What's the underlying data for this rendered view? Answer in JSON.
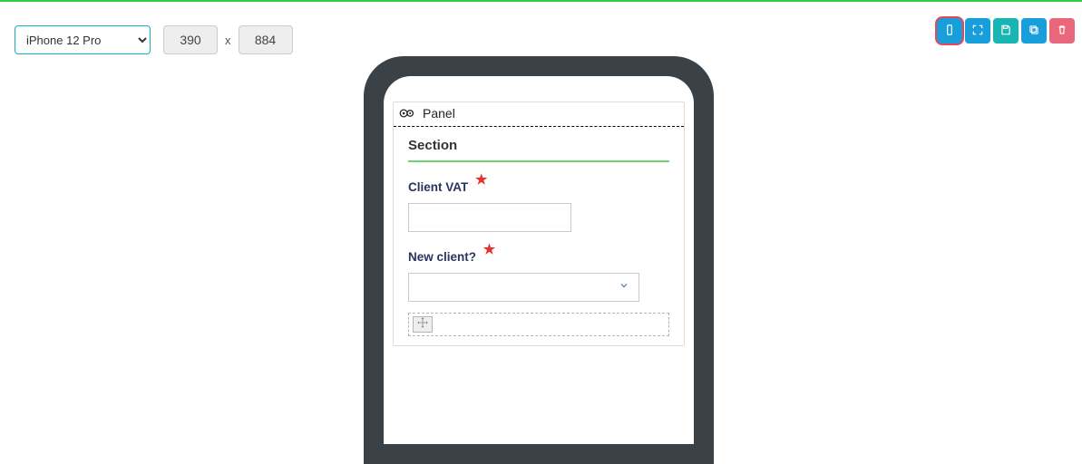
{
  "toolbar": {
    "device_selected": "iPhone 12 Pro",
    "width": "390",
    "height": "884",
    "separator": "x"
  },
  "actions": {
    "toggle_device": "toggle-device",
    "fullscreen": "fullscreen",
    "save": "save",
    "copy": "copy",
    "delete": "delete"
  },
  "panel": {
    "title": "Panel",
    "section_title": "Section",
    "fields": [
      {
        "label": "Client VAT",
        "type": "text",
        "required": true,
        "value": ""
      },
      {
        "label": "New client?",
        "type": "select",
        "required": true,
        "value": ""
      }
    ]
  }
}
